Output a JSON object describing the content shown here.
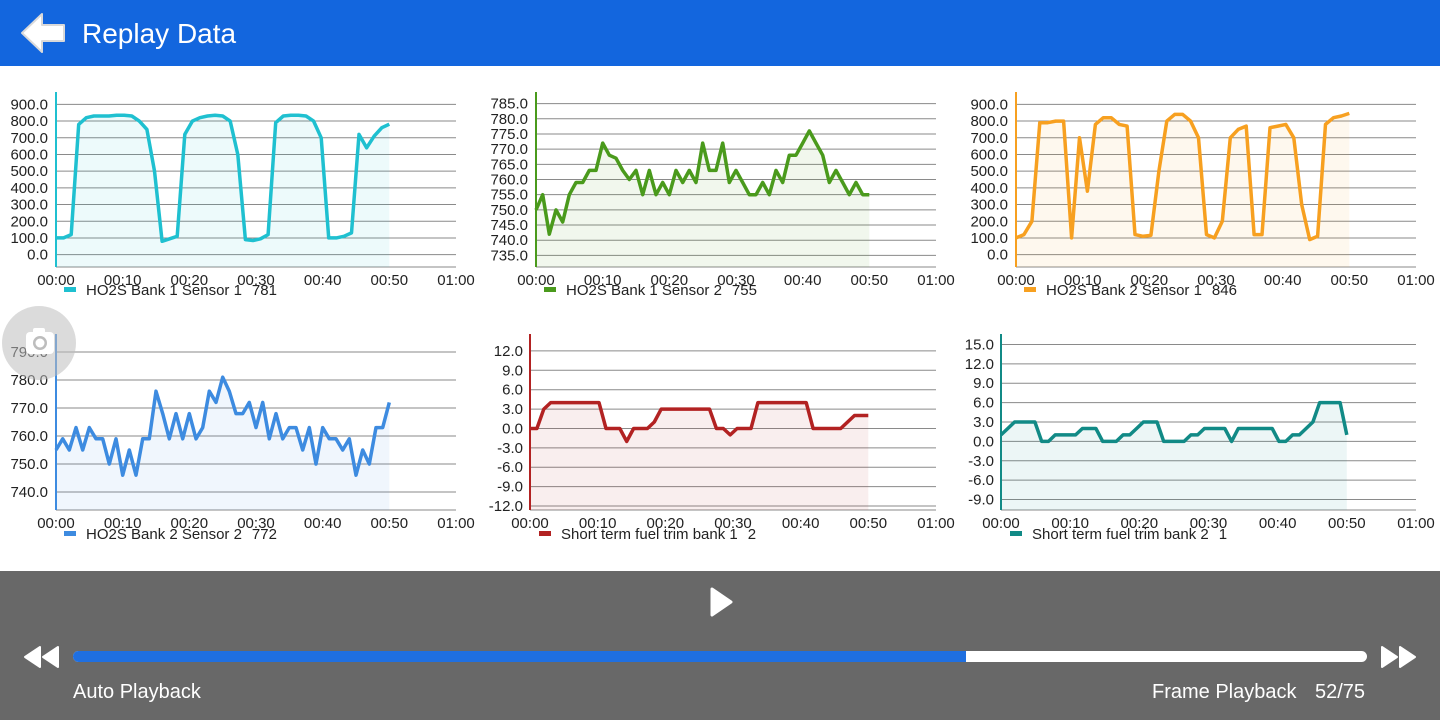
{
  "header": {
    "title": "Replay Data",
    "back_icon": "back-arrow-icon"
  },
  "colors": {
    "header_bg": "#1366de",
    "controls_bg": "#686868",
    "progress_fill": "#1f6fe0"
  },
  "controls": {
    "auto_playback_label": "Auto Playback",
    "frame_playback_label": "Frame Playback",
    "frame_counter": "52/75",
    "progress": 0.69,
    "play_icon": "play-icon",
    "rewind_icon": "rewind-icon",
    "fast_forward_icon": "fast-forward-icon",
    "camera_icon": "camera-icon"
  },
  "chart_data": [
    {
      "type": "area",
      "legend": "HO2S Bank 1 Sensor 1",
      "current_value": "781",
      "color": "#1fc0d0",
      "x_ticks": [
        "00:00",
        "00:10",
        "00:20",
        "00:30",
        "00:40",
        "00:50",
        "01:00"
      ],
      "y_ticks": [
        "900.0",
        "800.0",
        "700.0",
        "600.0",
        "500.0",
        "400.0",
        "300.0",
        "200.0",
        "100.0",
        "0.0"
      ],
      "ylim": [
        -50,
        950
      ],
      "x": [
        0,
        1,
        2,
        3,
        4,
        5,
        6,
        7,
        8,
        9,
        10,
        11,
        12,
        13,
        14,
        15,
        16,
        17,
        18,
        19,
        20,
        21,
        22,
        23,
        24,
        25,
        26,
        27,
        28,
        29,
        30,
        31,
        32,
        33,
        34,
        35,
        36,
        37,
        38,
        39,
        40,
        41,
        42,
        43,
        44,
        45,
        46,
        47,
        48,
        49,
        50
      ],
      "values": [
        100,
        100,
        120,
        780,
        820,
        830,
        830,
        830,
        835,
        835,
        830,
        800,
        750,
        500,
        80,
        95,
        110,
        720,
        800,
        820,
        830,
        835,
        830,
        800,
        600,
        90,
        85,
        95,
        120,
        790,
        830,
        835,
        835,
        830,
        800,
        700,
        100,
        100,
        110,
        130,
        720,
        640,
        710,
        760,
        781
      ]
    },
    {
      "type": "area",
      "legend": "HO2S Bank 1 Sensor 2",
      "current_value": "755",
      "color": "#4a9a1c",
      "x_ticks": [
        "00:00",
        "00:10",
        "00:20",
        "00:30",
        "00:40",
        "00:50",
        "01:00"
      ],
      "y_ticks": [
        "785.0",
        "780.0",
        "775.0",
        "770.0",
        "765.0",
        "760.0",
        "755.0",
        "750.0",
        "745.0",
        "740.0",
        "735.0"
      ],
      "ylim": [
        732.5,
        787.5
      ],
      "x": [
        0,
        1,
        2,
        3,
        4,
        5,
        6,
        7,
        8,
        9,
        10,
        11,
        12,
        13,
        14,
        15,
        16,
        17,
        18,
        19,
        20,
        21,
        22,
        23,
        24,
        25,
        26,
        27,
        28,
        29,
        30,
        31,
        32,
        33,
        34,
        35,
        36,
        37,
        38,
        39,
        40,
        41,
        42,
        43,
        44,
        45,
        46,
        47,
        48,
        49,
        50
      ],
      "values": [
        750,
        755,
        742,
        750,
        746,
        755,
        759,
        759,
        763,
        763,
        772,
        768,
        767,
        763,
        760,
        763,
        755,
        763,
        755,
        759,
        755,
        763,
        759,
        763,
        759,
        772,
        763,
        763,
        772,
        759,
        763,
        759,
        755,
        755,
        759,
        755,
        763,
        759,
        768,
        768,
        772,
        776,
        772,
        768,
        759,
        763,
        759,
        755,
        759,
        755,
        755
      ]
    },
    {
      "type": "area",
      "legend": "HO2S Bank 2 Sensor 1",
      "current_value": "846",
      "color": "#f7a020",
      "x_ticks": [
        "00:00",
        "00:10",
        "00:20",
        "00:30",
        "00:40",
        "00:50",
        "01:00"
      ],
      "y_ticks": [
        "900.0",
        "800.0",
        "700.0",
        "600.0",
        "500.0",
        "400.0",
        "300.0",
        "200.0",
        "100.0",
        "0.0"
      ],
      "ylim": [
        -50,
        950
      ],
      "x": [
        0,
        1,
        2,
        3,
        4,
        5,
        6,
        7,
        8,
        9,
        10,
        11,
        12,
        13,
        14,
        15,
        16,
        17,
        18,
        19,
        20,
        21,
        22,
        23,
        24,
        25,
        26,
        27,
        28,
        29,
        30,
        31,
        32,
        33,
        34,
        35,
        36,
        37,
        38,
        39,
        40,
        41,
        42,
        43,
        44,
        45,
        46,
        47,
        48,
        49,
        50
      ],
      "values": [
        100,
        120,
        200,
        790,
        790,
        800,
        800,
        100,
        700,
        380,
        780,
        820,
        820,
        780,
        770,
        120,
        110,
        115,
        500,
        800,
        840,
        840,
        800,
        700,
        120,
        100,
        200,
        700,
        750,
        770,
        120,
        120,
        760,
        770,
        780,
        700,
        300,
        90,
        110,
        780,
        820,
        830,
        846
      ]
    },
    {
      "type": "area",
      "legend": "HO2S Bank 2 Sensor 2",
      "current_value": "772",
      "color": "#3d8be0",
      "x_ticks": [
        "00:00",
        "00:10",
        "00:20",
        "00:30",
        "00:40",
        "00:50",
        "01:00"
      ],
      "y_ticks": [
        "790.0",
        "780.0",
        "770.0",
        "760.0",
        "750.0",
        "740.0"
      ],
      "ylim": [
        735,
        795
      ],
      "x": [
        0,
        1,
        2,
        3,
        4,
        5,
        6,
        7,
        8,
        9,
        10,
        11,
        12,
        13,
        14,
        15,
        16,
        17,
        18,
        19,
        20,
        21,
        22,
        23,
        24,
        25,
        26,
        27,
        28,
        29,
        30,
        31,
        32,
        33,
        34,
        35,
        36,
        37,
        38,
        39,
        40,
        41,
        42,
        43,
        44,
        45,
        46,
        47,
        48,
        49,
        50
      ],
      "values": [
        755,
        759,
        755,
        763,
        755,
        763,
        759,
        759,
        750,
        759,
        746,
        755,
        746,
        759,
        759,
        776,
        768,
        759,
        768,
        759,
        768,
        759,
        763,
        776,
        772,
        781,
        776,
        768,
        768,
        772,
        763,
        772,
        759,
        768,
        759,
        763,
        763,
        755,
        763,
        750,
        763,
        759,
        759,
        755,
        759,
        746,
        755,
        750,
        763,
        763,
        772
      ]
    },
    {
      "type": "area",
      "legend": "Short term fuel trim bank 1",
      "current_value": "2",
      "color": "#b22222",
      "x_ticks": [
        "00:00",
        "00:10",
        "00:20",
        "00:30",
        "00:40",
        "00:50",
        "01:00"
      ],
      "y_ticks": [
        "12.0",
        "9.0",
        "6.0",
        "3.0",
        "0.0",
        "-3.0",
        "-6.0",
        "-9.0",
        "-12.0"
      ],
      "ylim": [
        -12,
        14
      ],
      "x": [
        0,
        1,
        2,
        3,
        4,
        5,
        6,
        7,
        8,
        9,
        10,
        11,
        12,
        13,
        14,
        15,
        16,
        17,
        18,
        19,
        20,
        21,
        22,
        23,
        24,
        25,
        26,
        27,
        28,
        29,
        30,
        31,
        32,
        33,
        34,
        35,
        36,
        37,
        38,
        39,
        40,
        41,
        42,
        43,
        44,
        45,
        46,
        47,
        48,
        49,
        50
      ],
      "values": [
        0,
        0,
        3,
        4,
        4,
        4,
        4,
        4,
        4,
        4,
        4,
        0,
        0,
        0,
        -2,
        0,
        0,
        0,
        1,
        3,
        3,
        3,
        3,
        3,
        3,
        3,
        3,
        0,
        0,
        -1,
        0,
        0,
        0,
        4,
        4,
        4,
        4,
        4,
        4,
        4,
        4,
        0,
        0,
        0,
        0,
        0,
        1,
        2,
        2,
        2
      ]
    },
    {
      "type": "area",
      "legend": "Short term fuel trim bank 2",
      "current_value": "1",
      "color": "#118a86",
      "x_ticks": [
        "00:00",
        "00:10",
        "00:20",
        "00:30",
        "00:40",
        "00:50",
        "01:00"
      ],
      "y_ticks": [
        "15.0",
        "12.0",
        "9.0",
        "6.0",
        "3.0",
        "0.0",
        "-3.0",
        "-6.0",
        "-9.0"
      ],
      "ylim": [
        -10,
        16
      ],
      "x": [
        0,
        1,
        2,
        3,
        4,
        5,
        6,
        7,
        8,
        9,
        10,
        11,
        12,
        13,
        14,
        15,
        16,
        17,
        18,
        19,
        20,
        21,
        22,
        23,
        24,
        25,
        26,
        27,
        28,
        29,
        30,
        31,
        32,
        33,
        34,
        35,
        36,
        37,
        38,
        39,
        40,
        41,
        42,
        43,
        44,
        45,
        46,
        47,
        48,
        49,
        50
      ],
      "values": [
        1,
        2,
        3,
        3,
        3,
        3,
        0,
        0,
        1,
        1,
        1,
        1,
        2,
        2,
        2,
        0,
        0,
        0,
        1,
        1,
        2,
        3,
        3,
        3,
        0,
        0,
        0,
        0,
        1,
        1,
        2,
        2,
        2,
        2,
        0,
        2,
        2,
        2,
        2,
        2,
        2,
        0,
        0,
        1,
        1,
        2,
        3,
        6,
        6,
        6,
        6,
        1
      ]
    }
  ]
}
